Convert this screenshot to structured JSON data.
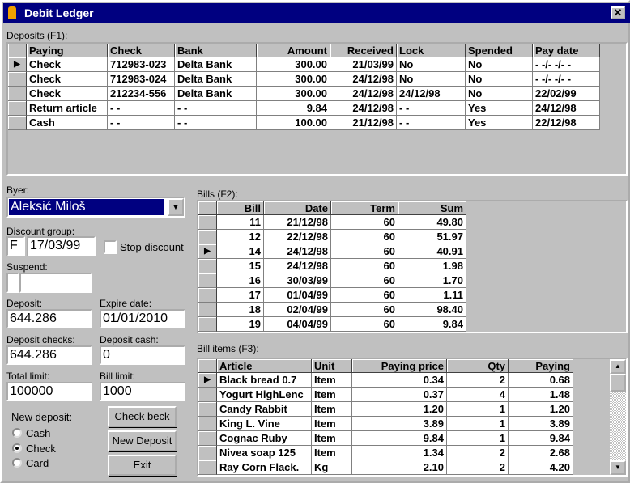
{
  "window": {
    "title": "Debit Ledger",
    "close": "✕"
  },
  "deposits": {
    "label": "Deposits (F1):",
    "columns": [
      "Paying",
      "Check",
      "Bank",
      "Amount",
      "Received",
      "Lock",
      "Spended",
      "Pay date"
    ],
    "rows": [
      [
        "Check",
        "712983-023",
        "Delta Bank",
        "300.00",
        "21/03/99",
        "No",
        "No",
        "- -/- -/- -"
      ],
      [
        "Check",
        "712983-024",
        "Delta Bank",
        "300.00",
        "24/12/98",
        "No",
        "No",
        "- -/- -/- -"
      ],
      [
        "Check",
        "212234-556",
        "Delta Bank",
        "300.00",
        "24/12/98",
        "24/12/98",
        "No",
        "22/02/99"
      ],
      [
        "Return article",
        "- -",
        "- -",
        "9.84",
        "24/12/98",
        "- -",
        "Yes",
        "24/12/98"
      ],
      [
        "Cash",
        "- -",
        "- -",
        "100.00",
        "21/12/98",
        "- -",
        "Yes",
        "22/12/98"
      ]
    ],
    "current": 0
  },
  "buyer": {
    "label": "Byer:",
    "value": "Aleksić Miloš"
  },
  "discount": {
    "label": "Discount group:",
    "group": "F",
    "date": "17/03/99",
    "stop_label": "Stop discount"
  },
  "suspend": {
    "label": "Suspend:",
    "value": ""
  },
  "deposit": {
    "label": "Deposit:",
    "value": "644.286"
  },
  "expire": {
    "label": "Expire date:",
    "value": "01/01/2010"
  },
  "deposit_checks": {
    "label": "Deposit checks:",
    "value": "644.286"
  },
  "deposit_cash": {
    "label": "Deposit cash:",
    "value": "0"
  },
  "total_limit": {
    "label": "Total limit:",
    "value": "100000"
  },
  "bill_limit": {
    "label": "Bill limit:",
    "value": "1000"
  },
  "new_deposit": {
    "label": "New deposit:",
    "options": [
      "Cash",
      "Check",
      "Card"
    ],
    "selected": "Check"
  },
  "buttons": {
    "check_beck": "Check beck",
    "new_deposit": "New Deposit",
    "exit": "Exit"
  },
  "bills": {
    "label": "Bills (F2):",
    "columns": [
      "Bill",
      "Date",
      "Term",
      "Sum"
    ],
    "rows": [
      [
        "11",
        "21/12/98",
        "60",
        "49.80"
      ],
      [
        "12",
        "22/12/98",
        "60",
        "51.97"
      ],
      [
        "14",
        "24/12/98",
        "60",
        "40.91"
      ],
      [
        "15",
        "24/12/98",
        "60",
        "1.98"
      ],
      [
        "16",
        "30/03/99",
        "60",
        "1.70"
      ],
      [
        "17",
        "01/04/99",
        "60",
        "1.11"
      ],
      [
        "18",
        "02/04/99",
        "60",
        "98.40"
      ],
      [
        "19",
        "04/04/99",
        "60",
        "9.84"
      ]
    ],
    "current": 2
  },
  "items": {
    "label": "Bill items (F3):",
    "columns": [
      "Article",
      "Unit",
      "Paying price",
      "Qty",
      "Paying"
    ],
    "rows": [
      [
        "Black bread 0.7",
        "Item",
        "0.34",
        "2",
        "0.68"
      ],
      [
        "Yogurt HighLenc",
        "Item",
        "0.37",
        "4",
        "1.48"
      ],
      [
        "Candy Rabbit",
        "Item",
        "1.20",
        "1",
        "1.20"
      ],
      [
        "King L. Vine",
        "Item",
        "3.89",
        "1",
        "3.89"
      ],
      [
        "Cognac Ruby",
        "Item",
        "9.84",
        "1",
        "9.84"
      ],
      [
        "Nivea soap 125",
        "Item",
        "1.34",
        "2",
        "2.68"
      ],
      [
        "Ray Corn Flack.",
        "Kg",
        "2.10",
        "2",
        "4.20"
      ]
    ],
    "current": 0
  }
}
